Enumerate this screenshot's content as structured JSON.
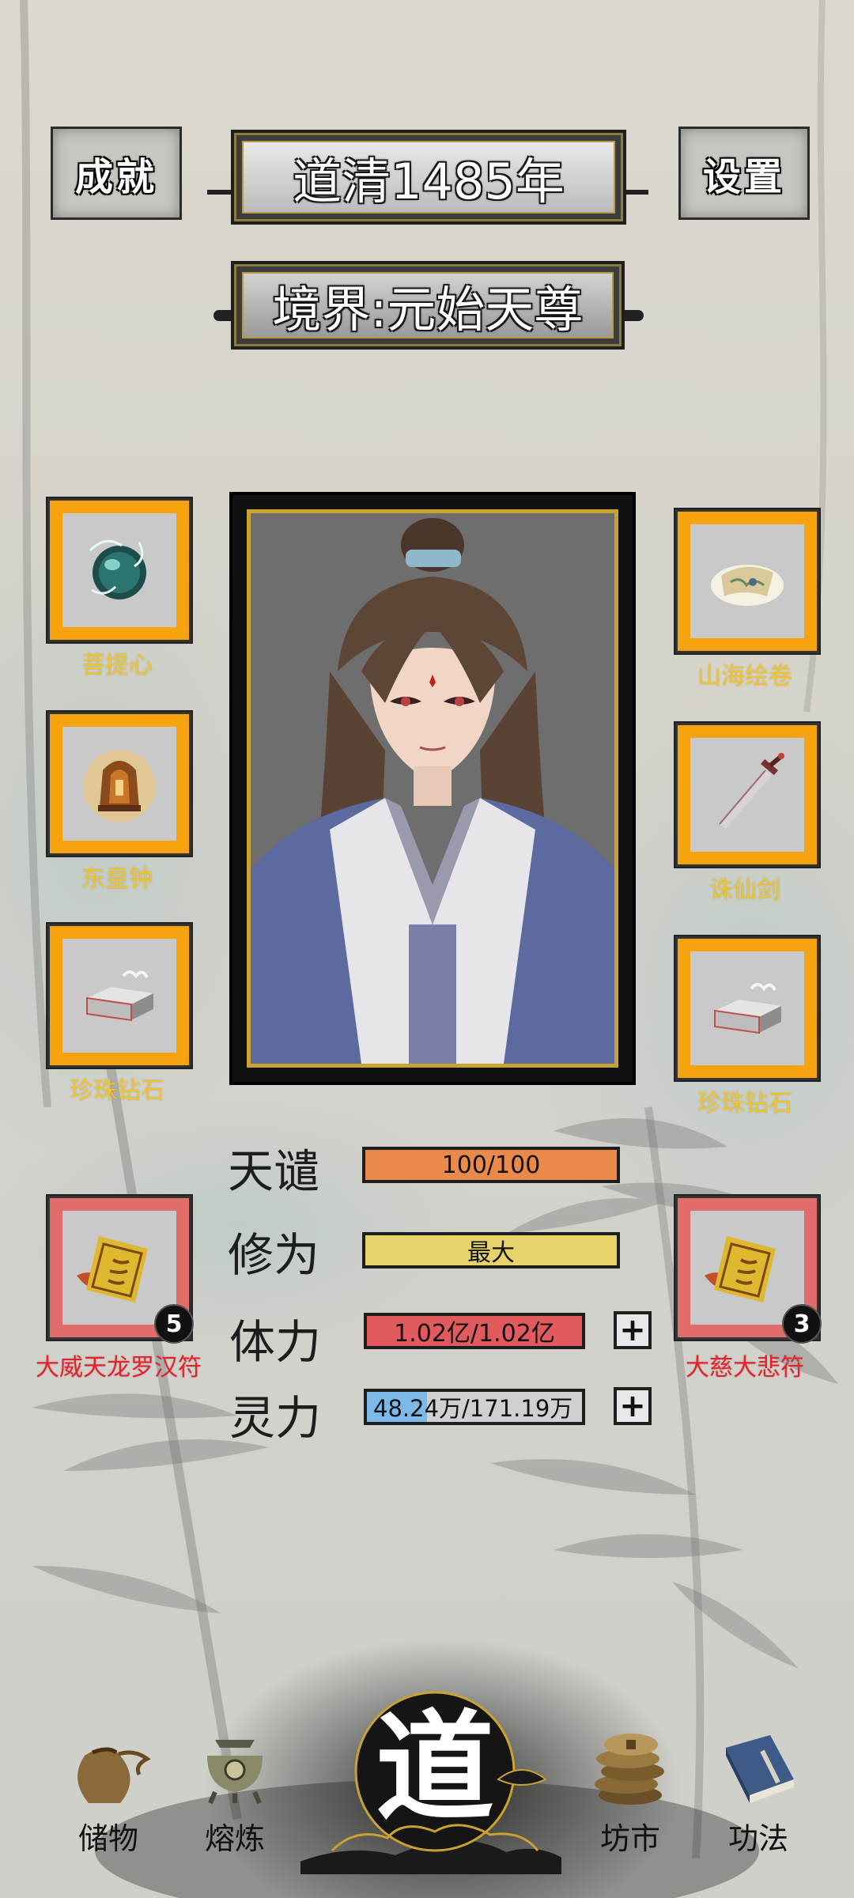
{
  "header": {
    "achievements_label": "成就",
    "year_text": "道清1485年",
    "settings_label": "设置",
    "realm_text": "境界:元始天尊"
  },
  "left_slots": [
    {
      "label": "菩提心",
      "icon": "bodhi-orb-icon"
    },
    {
      "label": "东皇钟",
      "icon": "bell-icon"
    },
    {
      "label": "珍珠钻石",
      "icon": "stone-block-icon"
    }
  ],
  "right_slots": [
    {
      "label": "山海绘卷",
      "icon": "scroll-map-icon"
    },
    {
      "label": "诛仙剑",
      "icon": "sword-icon"
    },
    {
      "label": "珍珠钻石",
      "icon": "stone-block-icon"
    }
  ],
  "talismans": {
    "left": {
      "label": "大威天龙罗汉符",
      "count": "5",
      "icon": "talisman-icon"
    },
    "right": {
      "label": "大慈大悲符",
      "count": "3",
      "icon": "talisman-icon"
    }
  },
  "stats": {
    "tianqian": {
      "label": "天谴",
      "value": "100/100",
      "fill": 1.0,
      "color": "#e98a4a"
    },
    "xiuwei": {
      "label": "修为",
      "value": "最大",
      "fill": 1.0,
      "color": "#e6d46a"
    },
    "tili": {
      "label": "体力",
      "value": "1.02亿/1.02亿",
      "fill": 1.0,
      "color": "#e25a5e"
    },
    "lingli": {
      "label": "灵力",
      "value": "48.24万/171.19万",
      "fill": 0.28,
      "color": "#7db9e8"
    },
    "plus_symbol": "+"
  },
  "nav": {
    "storage": "储物",
    "smelting": "熔炼",
    "dao": "道",
    "market": "坊市",
    "skills": "功法"
  }
}
